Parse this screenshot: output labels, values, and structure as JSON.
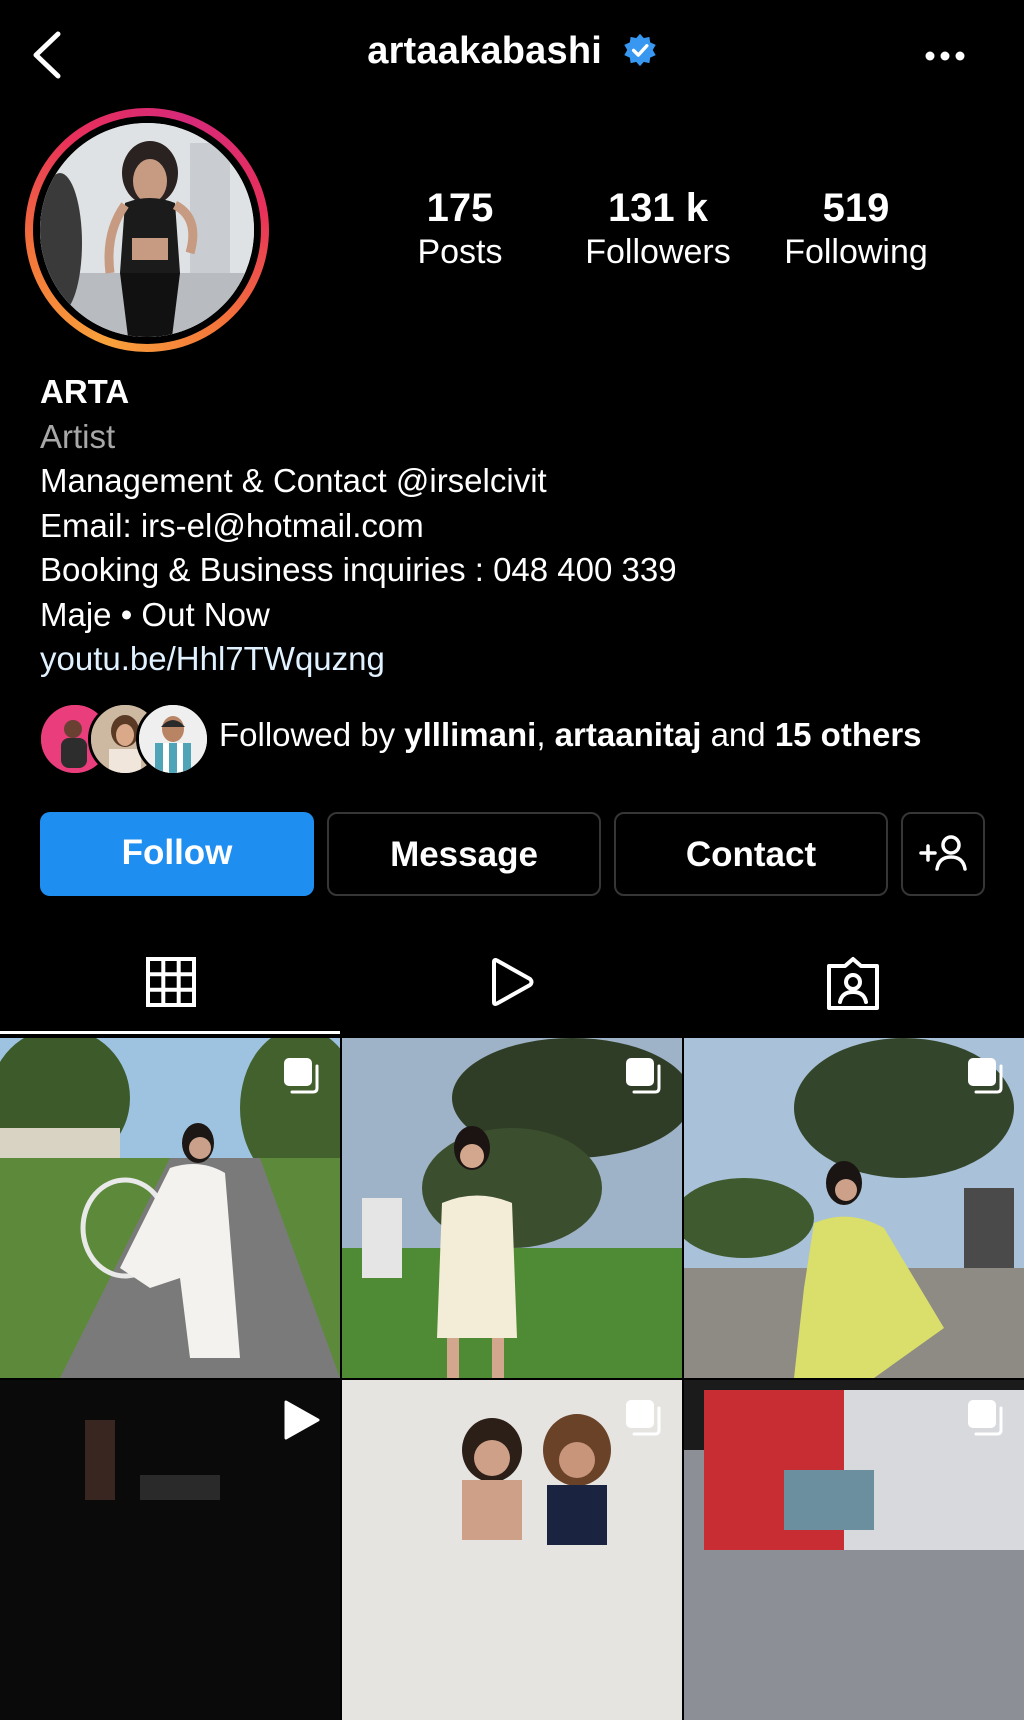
{
  "header": {
    "username": "artaakabashi",
    "verified_icon": "verified-badge-icon",
    "back_icon": "chevron-left-icon",
    "more_icon": "more-horizontal-icon"
  },
  "stats": [
    {
      "value": "175",
      "label": "Posts"
    },
    {
      "value": "131 k",
      "label": "Followers"
    },
    {
      "value": "519",
      "label": "Following"
    }
  ],
  "bio": {
    "name": "ARTA",
    "category": "Artist",
    "lines": [
      "Management & Contact @irselcivit",
      "Email: irs-el@hotmail.com",
      "Booking & Business inquiries : 048 400 339",
      "Maje • Out Now"
    ],
    "link": "youtu.be/Hhl7TWquzng"
  },
  "followed_by": {
    "prefix": "Followed by ",
    "user1": "ylllimani",
    "separator": ", ",
    "user2": "artaanitaj",
    "conj": " and ",
    "others": "15 others"
  },
  "actions": {
    "follow": "Follow",
    "message": "Message",
    "contact": "Contact",
    "add_user_icon": "add-user-icon"
  },
  "tabs": [
    {
      "icon": "grid-icon",
      "active": true
    },
    {
      "icon": "reels-play-icon",
      "active": false
    },
    {
      "icon": "tagged-user-icon",
      "active": false
    }
  ],
  "colors": {
    "accent": "#1f8ef1",
    "verified": "#3897f0",
    "background": "#000000",
    "secondary_text": "#a8a8a8"
  },
  "posts": [
    {
      "badge": "carousel-icon"
    },
    {
      "badge": "carousel-icon"
    },
    {
      "badge": "carousel-icon"
    },
    {
      "badge": "reel-play-icon"
    },
    {
      "badge": "carousel-icon"
    },
    {
      "badge": "carousel-icon"
    }
  ]
}
